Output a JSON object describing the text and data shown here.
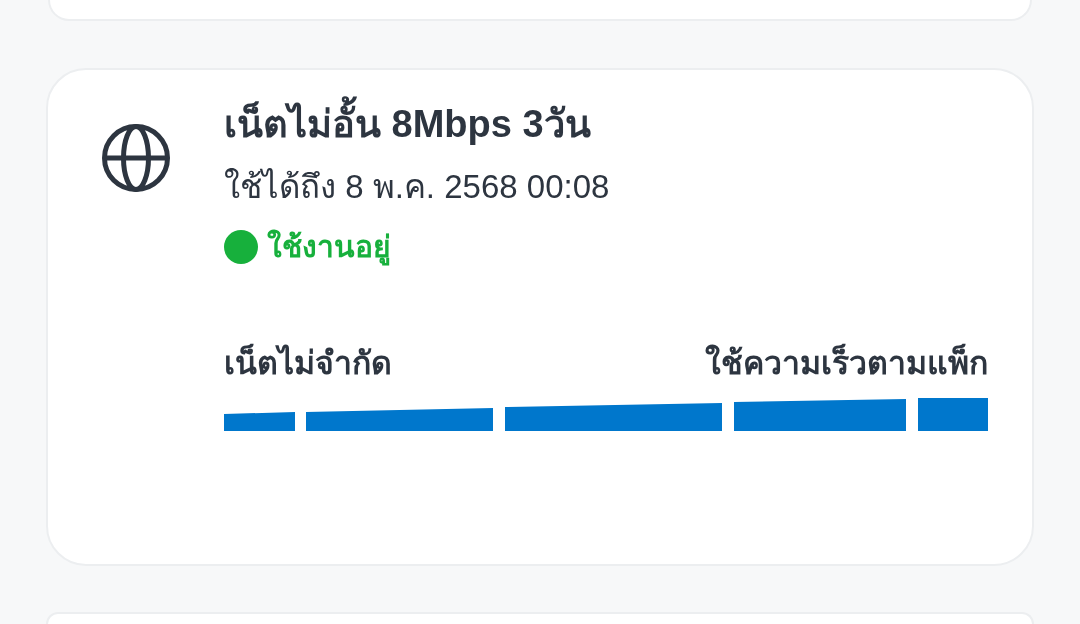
{
  "package": {
    "title": "เน็ตไม่อั้น 8Mbps 3วัน",
    "expiry": "ใช้ได้ถึง 8 พ.ค. 2568 00:08",
    "status": {
      "label": "ใช้งานอยู่",
      "active": true
    }
  },
  "speed": {
    "left_label": "เน็ตไม่จำกัด",
    "right_label": "ใช้ความเร็วตามแพ็ก"
  }
}
